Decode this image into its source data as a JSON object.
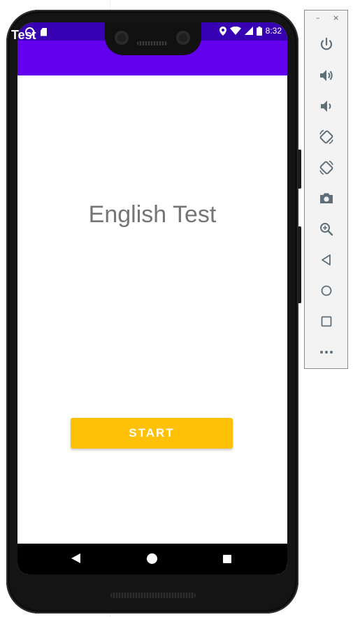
{
  "app": {
    "title": "Test"
  },
  "status_bar": {
    "time": "8:32",
    "left_icons": [
      "notification-ring-icon",
      "sd-card-icon"
    ],
    "right_icons": [
      "location-icon",
      "wifi-icon",
      "signal-icon",
      "battery-icon"
    ]
  },
  "main": {
    "heading": "English Test",
    "start_label": "START"
  },
  "nav": {
    "items": [
      "back-icon",
      "home-icon",
      "recents-icon"
    ]
  },
  "emulator_toolbar": {
    "window_controls": {
      "minimize": "–",
      "close": "×"
    },
    "items": [
      "power-icon",
      "volume-up-icon",
      "volume-down-icon",
      "rotate-left-icon",
      "rotate-right-icon",
      "camera-icon",
      "zoom-icon",
      "back-triangle-icon",
      "home-circle-icon",
      "overview-square-icon",
      "more-icon"
    ]
  },
  "colors": {
    "status_bar": "#3700b3",
    "app_bar": "#6200ee",
    "accent_button": "#ffc107",
    "heading_text": "#757575",
    "toolbar_icon": "#5f6f7a"
  }
}
